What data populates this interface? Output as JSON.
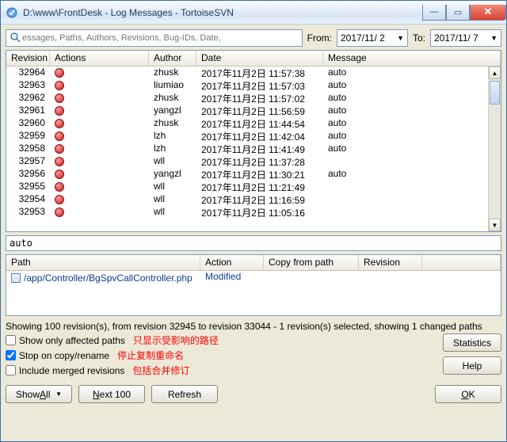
{
  "window": {
    "title": "D:\\www\\FrontDesk - Log Messages - TortoiseSVN"
  },
  "filter": {
    "placeholder": "essages, Paths, Authors, Revisions, Bug-IDs, Date,",
    "from_label": "From:",
    "from_date": "2017/11/ 2",
    "to_label": "To:",
    "to_date": "2017/11/ 7"
  },
  "columns": {
    "rev": "Revision",
    "actions": "Actions",
    "author": "Author",
    "date": "Date",
    "message": "Message"
  },
  "rows": [
    {
      "rev": "32964",
      "author": "zhusk",
      "date": "2017年11月2日 11:57:38",
      "msg": "auto"
    },
    {
      "rev": "32963",
      "author": "liumiao",
      "date": "2017年11月2日 11:57:03",
      "msg": "auto"
    },
    {
      "rev": "32962",
      "author": "zhusk",
      "date": "2017年11月2日 11:57:02",
      "msg": "auto"
    },
    {
      "rev": "32961",
      "author": "yangzl",
      "date": "2017年11月2日 11:56:59",
      "msg": "auto"
    },
    {
      "rev": "32960",
      "author": "zhusk",
      "date": "2017年11月2日 11:44:54",
      "msg": "auto"
    },
    {
      "rev": "32959",
      "author": "lzh",
      "date": "2017年11月2日 11:42:04",
      "msg": "auto"
    },
    {
      "rev": "32958",
      "author": "lzh",
      "date": "2017年11月2日 11:41:49",
      "msg": "auto"
    },
    {
      "rev": "32957",
      "author": "wll",
      "date": "2017年11月2日 11:37:28",
      "msg": ""
    },
    {
      "rev": "32956",
      "author": "yangzl",
      "date": "2017年11月2日 11:30:21",
      "msg": "auto"
    },
    {
      "rev": "32955",
      "author": "wll",
      "date": "2017年11月2日 11:21:49",
      "msg": ""
    },
    {
      "rev": "32954",
      "author": "wll",
      "date": "2017年11月2日 11:16:59",
      "msg": ""
    },
    {
      "rev": "32953",
      "author": "wll",
      "date": "2017年11月2日 11:05:16",
      "msg": ""
    }
  ],
  "selected_message": "auto",
  "paths_columns": {
    "path": "Path",
    "action": "Action",
    "copy": "Copy from path",
    "rev": "Revision"
  },
  "paths_rows": [
    {
      "path": "/app/Controller/BgSpvCallController.php",
      "action": "Modified",
      "copy": "",
      "rev": ""
    }
  ],
  "status_text": "Showing 100 revision(s), from revision 32945 to revision 33044 - 1 revision(s) selected, showing 1 changed paths",
  "checks": {
    "affected": "Show only affected paths",
    "affected_ann": "只显示受影响的路径",
    "stop": "Stop on copy/rename",
    "stop_ann": "停止复制重命名",
    "merged": "Include merged revisions",
    "merged_ann": "包括合并修订"
  },
  "buttons": {
    "statistics": "Statistics",
    "help": "Help",
    "show_all_pre": "Show ",
    "show_all_u": "A",
    "show_all_post": "ll",
    "next_u": "N",
    "next_post": "ext 100",
    "refresh": "Refresh",
    "ok_u": "O",
    "ok_post": "K"
  }
}
